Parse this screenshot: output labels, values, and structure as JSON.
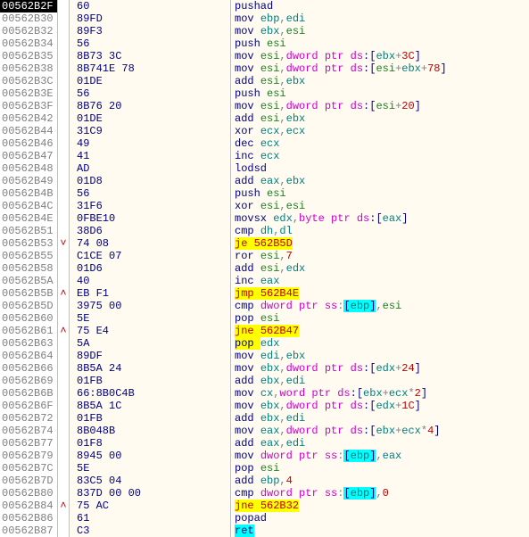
{
  "rows": [
    {
      "addr": "00562B2F",
      "current": true,
      "marker": "",
      "bytes": "60",
      "dis": [
        {
          "t": "pushad",
          "c": "mn"
        }
      ]
    },
    {
      "addr": "00562B30",
      "bytes": "89FD",
      "dis": [
        {
          "t": "mov ",
          "c": "mn"
        },
        {
          "t": "ebp",
          "c": "reg"
        },
        {
          "t": ",",
          "c": "plain"
        },
        {
          "t": "edi",
          "c": "reg"
        }
      ]
    },
    {
      "addr": "00562B32",
      "bytes": "89F3",
      "dis": [
        {
          "t": "mov ",
          "c": "mn"
        },
        {
          "t": "ebx",
          "c": "reg"
        },
        {
          "t": ",",
          "c": "plain"
        },
        {
          "t": "esi",
          "c": "reg-x"
        }
      ]
    },
    {
      "addr": "00562B34",
      "bytes": "56",
      "dis": [
        {
          "t": "push ",
          "c": "mn"
        },
        {
          "t": "esi",
          "c": "reg-x"
        }
      ]
    },
    {
      "addr": "00562B35",
      "bytes": "8B73 3C",
      "dis": [
        {
          "t": "mov ",
          "c": "mn"
        },
        {
          "t": "esi",
          "c": "reg-x"
        },
        {
          "t": ",",
          "c": "plain"
        },
        {
          "t": "dword ptr ",
          "c": "kw"
        },
        {
          "t": "ds",
          "c": "seg"
        },
        {
          "t": ":[",
          "c": "br"
        },
        {
          "t": "ebx",
          "c": "reg"
        },
        {
          "t": "+",
          "c": "plain"
        },
        {
          "t": "3C",
          "c": "imm"
        },
        {
          "t": "]",
          "c": "br"
        }
      ]
    },
    {
      "addr": "00562B38",
      "bytes": "8B741E 78",
      "dis": [
        {
          "t": "mov ",
          "c": "mn"
        },
        {
          "t": "esi",
          "c": "reg-x"
        },
        {
          "t": ",",
          "c": "plain"
        },
        {
          "t": "dword ptr ",
          "c": "kw"
        },
        {
          "t": "ds",
          "c": "seg"
        },
        {
          "t": ":[",
          "c": "br"
        },
        {
          "t": "esi",
          "c": "reg-x"
        },
        {
          "t": "+",
          "c": "plain"
        },
        {
          "t": "ebx",
          "c": "reg"
        },
        {
          "t": "+",
          "c": "plain"
        },
        {
          "t": "78",
          "c": "imm"
        },
        {
          "t": "]",
          "c": "br"
        }
      ]
    },
    {
      "addr": "00562B3C",
      "bytes": "01DE",
      "dis": [
        {
          "t": "add ",
          "c": "mn"
        },
        {
          "t": "esi",
          "c": "reg-x"
        },
        {
          "t": ",",
          "c": "plain"
        },
        {
          "t": "ebx",
          "c": "reg"
        }
      ]
    },
    {
      "addr": "00562B3E",
      "bytes": "56",
      "dis": [
        {
          "t": "push ",
          "c": "mn"
        },
        {
          "t": "esi",
          "c": "reg-x"
        }
      ]
    },
    {
      "addr": "00562B3F",
      "bytes": "8B76 20",
      "dis": [
        {
          "t": "mov ",
          "c": "mn"
        },
        {
          "t": "esi",
          "c": "reg-x"
        },
        {
          "t": ",",
          "c": "plain"
        },
        {
          "t": "dword ptr ",
          "c": "kw"
        },
        {
          "t": "ds",
          "c": "seg"
        },
        {
          "t": ":[",
          "c": "br"
        },
        {
          "t": "esi",
          "c": "reg-x"
        },
        {
          "t": "+",
          "c": "plain"
        },
        {
          "t": "20",
          "c": "imm"
        },
        {
          "t": "]",
          "c": "br"
        }
      ]
    },
    {
      "addr": "00562B42",
      "bytes": "01DE",
      "dis": [
        {
          "t": "add ",
          "c": "mn"
        },
        {
          "t": "esi",
          "c": "reg-x"
        },
        {
          "t": ",",
          "c": "plain"
        },
        {
          "t": "ebx",
          "c": "reg"
        }
      ]
    },
    {
      "addr": "00562B44",
      "bytes": "31C9",
      "dis": [
        {
          "t": "xor ",
          "c": "mn"
        },
        {
          "t": "ecx",
          "c": "reg"
        },
        {
          "t": ",",
          "c": "plain"
        },
        {
          "t": "ecx",
          "c": "reg"
        }
      ]
    },
    {
      "addr": "00562B46",
      "bytes": "49",
      "dis": [
        {
          "t": "dec ",
          "c": "mn"
        },
        {
          "t": "ecx",
          "c": "reg"
        }
      ]
    },
    {
      "addr": "00562B47",
      "bytes": "41",
      "dis": [
        {
          "t": "inc ",
          "c": "mn"
        },
        {
          "t": "ecx",
          "c": "reg"
        }
      ]
    },
    {
      "addr": "00562B48",
      "bytes": "AD",
      "dis": [
        {
          "t": "lodsd",
          "c": "mn"
        }
      ]
    },
    {
      "addr": "00562B49",
      "bytes": "01D8",
      "dis": [
        {
          "t": "add ",
          "c": "mn"
        },
        {
          "t": "eax",
          "c": "reg"
        },
        {
          "t": ",",
          "c": "plain"
        },
        {
          "t": "ebx",
          "c": "reg"
        }
      ]
    },
    {
      "addr": "00562B4B",
      "bytes": "56",
      "dis": [
        {
          "t": "push ",
          "c": "mn"
        },
        {
          "t": "esi",
          "c": "reg-x"
        }
      ]
    },
    {
      "addr": "00562B4C",
      "bytes": "31F6",
      "dis": [
        {
          "t": "xor ",
          "c": "mn"
        },
        {
          "t": "esi",
          "c": "reg-x"
        },
        {
          "t": ",",
          "c": "plain"
        },
        {
          "t": "esi",
          "c": "reg-x"
        }
      ]
    },
    {
      "addr": "00562B4E",
      "bytes": "0FBE10",
      "dis": [
        {
          "t": "movsx ",
          "c": "mn"
        },
        {
          "t": "edx",
          "c": "reg"
        },
        {
          "t": ",",
          "c": "plain"
        },
        {
          "t": "byte ptr ",
          "c": "kw"
        },
        {
          "t": "ds",
          "c": "seg"
        },
        {
          "t": ":[",
          "c": "br"
        },
        {
          "t": "eax",
          "c": "reg"
        },
        {
          "t": "]",
          "c": "br"
        }
      ]
    },
    {
      "addr": "00562B51",
      "bytes": "38D6",
      "dis": [
        {
          "t": "cmp ",
          "c": "mn"
        },
        {
          "t": "dh",
          "c": "reg"
        },
        {
          "t": ",",
          "c": "plain"
        },
        {
          "t": "dl",
          "c": "reg"
        }
      ]
    },
    {
      "addr": "00562B53",
      "marker": "˅",
      "bytes": "74 08",
      "dis": [
        {
          "t": "je ",
          "c": "mn-j",
          "hl": "hl-y"
        },
        {
          "t": "562B5D",
          "c": "addref",
          "hl": "hl-y"
        }
      ]
    },
    {
      "addr": "00562B55",
      "bytes": "C1CE 07",
      "dis": [
        {
          "t": "ror ",
          "c": "mn"
        },
        {
          "t": "esi",
          "c": "reg-x"
        },
        {
          "t": ",",
          "c": "plain"
        },
        {
          "t": "7",
          "c": "imm"
        }
      ]
    },
    {
      "addr": "00562B58",
      "bytes": "01D6",
      "dis": [
        {
          "t": "add ",
          "c": "mn"
        },
        {
          "t": "esi",
          "c": "reg-x"
        },
        {
          "t": ",",
          "c": "plain"
        },
        {
          "t": "edx",
          "c": "reg"
        }
      ]
    },
    {
      "addr": "00562B5A",
      "bytes": "40",
      "dis": [
        {
          "t": "inc ",
          "c": "mn"
        },
        {
          "t": "eax",
          "c": "reg"
        }
      ]
    },
    {
      "addr": "00562B5B",
      "marker": "˄",
      "bytes": "EB F1",
      "dis": [
        {
          "t": "jmp ",
          "c": "mn-j",
          "hl": "hl-y"
        },
        {
          "t": "562B4E",
          "c": "addref",
          "hl": "hl-y"
        }
      ]
    },
    {
      "addr": "00562B5D",
      "bytes": "3975 00",
      "dis": [
        {
          "t": "cmp ",
          "c": "mn"
        },
        {
          "t": "dword ptr ",
          "c": "kw"
        },
        {
          "t": "ss",
          "c": "seg"
        },
        {
          "t": ":",
          "c": "plain"
        },
        {
          "t": "[",
          "c": "br",
          "hl": "hl-c"
        },
        {
          "t": "ebp",
          "c": "reg",
          "hl": "hl-c"
        },
        {
          "t": "]",
          "c": "br",
          "hl": "hl-c"
        },
        {
          "t": ",",
          "c": "plain"
        },
        {
          "t": "esi",
          "c": "reg-x"
        }
      ]
    },
    {
      "addr": "00562B60",
      "bytes": "5E",
      "dis": [
        {
          "t": "pop ",
          "c": "mn"
        },
        {
          "t": "esi",
          "c": "reg-x"
        }
      ]
    },
    {
      "addr": "00562B61",
      "marker": "˄",
      "bytes": "75 E4",
      "dis": [
        {
          "t": "jne ",
          "c": "mn-j",
          "hl": "hl-y"
        },
        {
          "t": "562B47",
          "c": "addref",
          "hl": "hl-y"
        }
      ]
    },
    {
      "addr": "00562B63",
      "bytes": "5A",
      "dis": [
        {
          "t": "pop ",
          "c": "mn",
          "hl": "hl-y"
        },
        {
          "t": "edx",
          "c": "reg"
        }
      ]
    },
    {
      "addr": "00562B64",
      "bytes": "89DF",
      "dis": [
        {
          "t": "mov ",
          "c": "mn"
        },
        {
          "t": "edi",
          "c": "reg"
        },
        {
          "t": ",",
          "c": "plain"
        },
        {
          "t": "ebx",
          "c": "reg"
        }
      ]
    },
    {
      "addr": "00562B66",
      "bytes": "8B5A 24",
      "dis": [
        {
          "t": "mov ",
          "c": "mn"
        },
        {
          "t": "ebx",
          "c": "reg"
        },
        {
          "t": ",",
          "c": "plain"
        },
        {
          "t": "dword ptr ",
          "c": "kw"
        },
        {
          "t": "ds",
          "c": "seg"
        },
        {
          "t": ":[",
          "c": "br"
        },
        {
          "t": "edx",
          "c": "reg"
        },
        {
          "t": "+",
          "c": "plain"
        },
        {
          "t": "24",
          "c": "imm"
        },
        {
          "t": "]",
          "c": "br"
        }
      ]
    },
    {
      "addr": "00562B69",
      "bytes": "01FB",
      "dis": [
        {
          "t": "add ",
          "c": "mn"
        },
        {
          "t": "ebx",
          "c": "reg"
        },
        {
          "t": ",",
          "c": "plain"
        },
        {
          "t": "edi",
          "c": "reg"
        }
      ]
    },
    {
      "addr": "00562B6B",
      "bytes": "66:8B0C4B",
      "dis": [
        {
          "t": "mov ",
          "c": "mn"
        },
        {
          "t": "cx",
          "c": "reg"
        },
        {
          "t": ",",
          "c": "plain"
        },
        {
          "t": "word ptr ",
          "c": "kw"
        },
        {
          "t": "ds",
          "c": "seg"
        },
        {
          "t": ":[",
          "c": "br"
        },
        {
          "t": "ebx",
          "c": "reg"
        },
        {
          "t": "+",
          "c": "plain"
        },
        {
          "t": "ecx",
          "c": "reg"
        },
        {
          "t": "*",
          "c": "plain"
        },
        {
          "t": "2",
          "c": "imm"
        },
        {
          "t": "]",
          "c": "br"
        }
      ]
    },
    {
      "addr": "00562B6F",
      "bytes": "8B5A 1C",
      "dis": [
        {
          "t": "mov ",
          "c": "mn"
        },
        {
          "t": "ebx",
          "c": "reg"
        },
        {
          "t": ",",
          "c": "plain"
        },
        {
          "t": "dword ptr ",
          "c": "kw"
        },
        {
          "t": "ds",
          "c": "seg"
        },
        {
          "t": ":[",
          "c": "br"
        },
        {
          "t": "edx",
          "c": "reg"
        },
        {
          "t": "+",
          "c": "plain"
        },
        {
          "t": "1C",
          "c": "imm"
        },
        {
          "t": "]",
          "c": "br"
        }
      ]
    },
    {
      "addr": "00562B72",
      "bytes": "01FB",
      "dis": [
        {
          "t": "add ",
          "c": "mn"
        },
        {
          "t": "ebx",
          "c": "reg"
        },
        {
          "t": ",",
          "c": "plain"
        },
        {
          "t": "edi",
          "c": "reg"
        }
      ]
    },
    {
      "addr": "00562B74",
      "bytes": "8B048B",
      "dis": [
        {
          "t": "mov ",
          "c": "mn"
        },
        {
          "t": "eax",
          "c": "reg"
        },
        {
          "t": ",",
          "c": "plain"
        },
        {
          "t": "dword ptr ",
          "c": "kw"
        },
        {
          "t": "ds",
          "c": "seg"
        },
        {
          "t": ":[",
          "c": "br"
        },
        {
          "t": "ebx",
          "c": "reg"
        },
        {
          "t": "+",
          "c": "plain"
        },
        {
          "t": "ecx",
          "c": "reg"
        },
        {
          "t": "*",
          "c": "plain"
        },
        {
          "t": "4",
          "c": "imm"
        },
        {
          "t": "]",
          "c": "br"
        }
      ]
    },
    {
      "addr": "00562B77",
      "bytes": "01F8",
      "dis": [
        {
          "t": "add ",
          "c": "mn"
        },
        {
          "t": "eax",
          "c": "reg"
        },
        {
          "t": ",",
          "c": "plain"
        },
        {
          "t": "edi",
          "c": "reg"
        }
      ]
    },
    {
      "addr": "00562B79",
      "bytes": "8945 00",
      "dis": [
        {
          "t": "mov ",
          "c": "mn"
        },
        {
          "t": "dword ptr ",
          "c": "kw"
        },
        {
          "t": "ss",
          "c": "seg"
        },
        {
          "t": ":",
          "c": "plain"
        },
        {
          "t": "[",
          "c": "br",
          "hl": "hl-c"
        },
        {
          "t": "ebp",
          "c": "reg",
          "hl": "hl-c"
        },
        {
          "t": "]",
          "c": "br",
          "hl": "hl-c"
        },
        {
          "t": ",",
          "c": "plain"
        },
        {
          "t": "eax",
          "c": "reg"
        }
      ]
    },
    {
      "addr": "00562B7C",
      "bytes": "5E",
      "dis": [
        {
          "t": "pop ",
          "c": "mn"
        },
        {
          "t": "esi",
          "c": "reg-x"
        }
      ]
    },
    {
      "addr": "00562B7D",
      "bytes": "83C5 04",
      "dis": [
        {
          "t": "add ",
          "c": "mn"
        },
        {
          "t": "ebp",
          "c": "reg"
        },
        {
          "t": ",",
          "c": "plain"
        },
        {
          "t": "4",
          "c": "imm"
        }
      ]
    },
    {
      "addr": "00562B80",
      "bytes": "837D 00 00",
      "dis": [
        {
          "t": "cmp ",
          "c": "mn"
        },
        {
          "t": "dword ptr ",
          "c": "kw"
        },
        {
          "t": "ss",
          "c": "seg"
        },
        {
          "t": ":",
          "c": "plain"
        },
        {
          "t": "[",
          "c": "br",
          "hl": "hl-c"
        },
        {
          "t": "ebp",
          "c": "reg",
          "hl": "hl-c"
        },
        {
          "t": "]",
          "c": "br",
          "hl": "hl-c"
        },
        {
          "t": ",",
          "c": "plain"
        },
        {
          "t": "0",
          "c": "imm"
        }
      ]
    },
    {
      "addr": "00562B84",
      "marker": "˄",
      "bytes": "75 AC",
      "dis": [
        {
          "t": "jne ",
          "c": "mn-j",
          "hl": "hl-y"
        },
        {
          "t": "562B32",
          "c": "addref",
          "hl": "hl-y"
        }
      ]
    },
    {
      "addr": "00562B86",
      "bytes": "61",
      "dis": [
        {
          "t": "popad",
          "c": "mn"
        }
      ]
    },
    {
      "addr": "00562B87",
      "bytes": "C3",
      "dis": [
        {
          "t": "ret",
          "c": "mn",
          "hl": "hl-c"
        }
      ]
    }
  ]
}
